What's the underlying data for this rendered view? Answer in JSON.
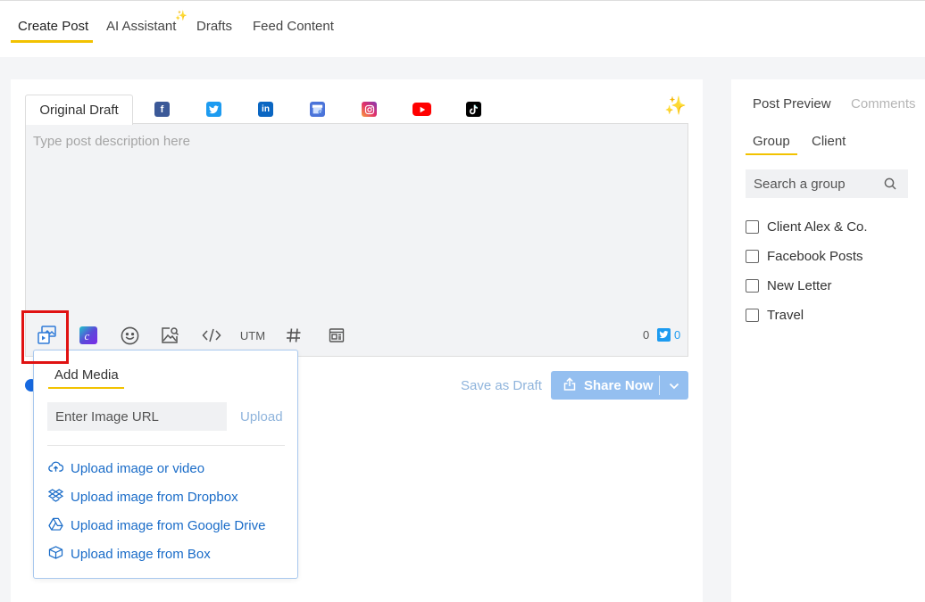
{
  "top_tabs": [
    {
      "label": "Create Post",
      "active": true
    },
    {
      "label": "AI Assistant"
    },
    {
      "label": "Drafts"
    },
    {
      "label": "Feed Content"
    }
  ],
  "editor": {
    "draft_tab_label": "Original Draft",
    "networks": [
      "facebook-icon",
      "twitter-icon",
      "linkedin-icon",
      "google-business-icon",
      "instagram-icon",
      "youtube-icon",
      "tiktok-icon"
    ],
    "description_placeholder": "Type post description here",
    "value": "",
    "toolbar": {
      "utm_label": "UTM",
      "char_count": "0",
      "twitter_count": "0"
    }
  },
  "actions": {
    "save_draft_label": "Save as Draft",
    "share_now_label": "Share Now"
  },
  "add_media": {
    "title": "Add Media",
    "url_placeholder": "Enter Image URL",
    "upload_label": "Upload",
    "options": [
      {
        "label": "Upload image or video",
        "icon": "cloud-upload-icon"
      },
      {
        "label": "Upload image from Dropbox",
        "icon": "dropbox-icon"
      },
      {
        "label": "Upload image from Google Drive",
        "icon": "google-drive-icon"
      },
      {
        "label": "Upload image from Box",
        "icon": "box-icon"
      }
    ]
  },
  "side_panel": {
    "tabs": [
      {
        "label": "Post Preview",
        "active": true
      },
      {
        "label": "Comments",
        "active": false
      }
    ],
    "subtabs": [
      {
        "label": "Group",
        "active": true
      },
      {
        "label": "Client",
        "active": false
      }
    ],
    "search_placeholder": "Search a group",
    "groups": [
      {
        "label": "Client Alex & Co.",
        "checked": false
      },
      {
        "label": "Facebook Posts",
        "checked": false
      },
      {
        "label": "New Letter",
        "checked": false
      },
      {
        "label": "Travel",
        "checked": false
      }
    ]
  },
  "colors": {
    "accent_yellow": "#f2c200",
    "link_blue": "#1a6cc8",
    "share_button": "#94bff0",
    "highlight_red": "#e01212"
  }
}
